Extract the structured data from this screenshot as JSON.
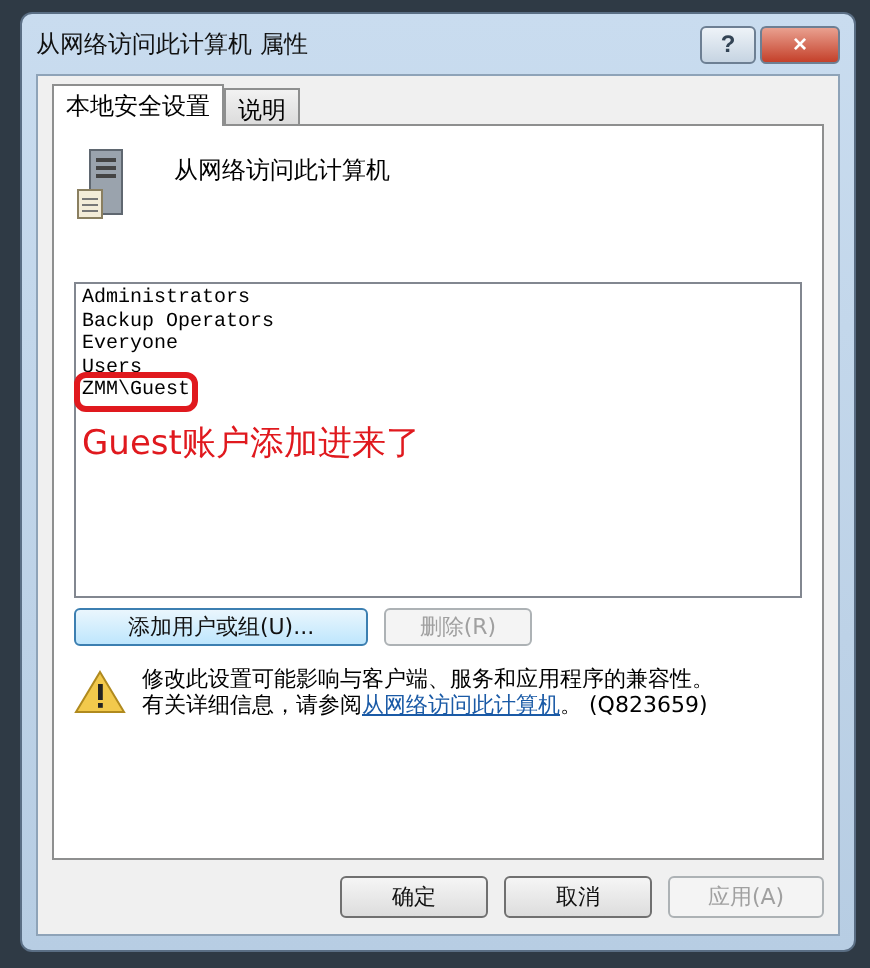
{
  "window": {
    "title": "从网络访问此计算机 属性",
    "help_button": "?",
    "close_button": "×"
  },
  "tabs": [
    {
      "label": "本地安全设置",
      "selected": true
    },
    {
      "label": "说明",
      "selected": false
    }
  ],
  "policy": {
    "name": "从网络访问此计算机"
  },
  "members": [
    {
      "name": "Administrators",
      "highlighted": false
    },
    {
      "name": "Backup Operators",
      "highlighted": false
    },
    {
      "name": "Everyone",
      "highlighted": false
    },
    {
      "name": "Users",
      "highlighted": false
    },
    {
      "name": "ZMM\\Guest",
      "highlighted": true
    }
  ],
  "annotation": "Guest账户添加进来了",
  "actions": [
    {
      "label": "添加用户或组(U)...",
      "disabled": false
    },
    {
      "label": "删除(R)",
      "disabled": true
    }
  ],
  "warning": {
    "line1": "修改此设置可能影响与客户端、服务和应用程序的兼容性。",
    "line2_prefix": "有关详细信息，请参阅",
    "link": "从网络访问此计算机",
    "line2_suffix": "。 (Q823659)"
  },
  "buttons": [
    {
      "label": "确定",
      "disabled": false
    },
    {
      "label": "取消",
      "disabled": false
    },
    {
      "label": "应用(A)",
      "disabled": true
    }
  ]
}
